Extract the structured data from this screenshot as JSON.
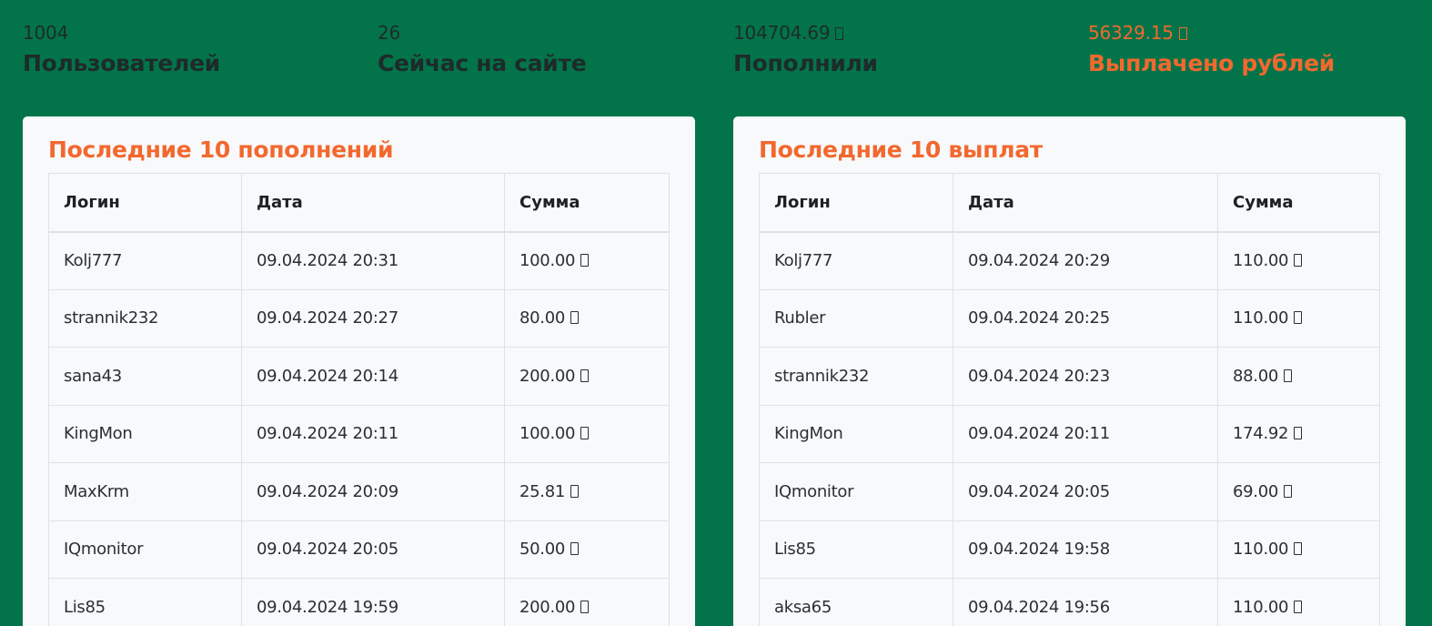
{
  "currency_glyph": "square-glyph-icon",
  "stats": [
    {
      "value": "1004",
      "label": "Пользователей"
    },
    {
      "value": "26",
      "label": "Сейчас на сайте"
    },
    {
      "value": "104704.69",
      "label": "Пополнили"
    },
    {
      "value": "56329.15",
      "label": "Выплачено рублей"
    }
  ],
  "deposits": {
    "title": "Последние 10 пополнений",
    "headers": {
      "login": "Логин",
      "date": "Дата",
      "sum": "Сумма"
    },
    "rows": [
      {
        "login": "Kolj777",
        "date": "09.04.2024 20:31",
        "sum": "100.00"
      },
      {
        "login": "strannik232",
        "date": "09.04.2024 20:27",
        "sum": "80.00"
      },
      {
        "login": "sana43",
        "date": "09.04.2024 20:14",
        "sum": "200.00"
      },
      {
        "login": "KingMon",
        "date": "09.04.2024 20:11",
        "sum": "100.00"
      },
      {
        "login": "MaxKrm",
        "date": "09.04.2024 20:09",
        "sum": "25.81"
      },
      {
        "login": "IQmonitor",
        "date": "09.04.2024 20:05",
        "sum": "50.00"
      },
      {
        "login": "Lis85",
        "date": "09.04.2024 19:59",
        "sum": "200.00"
      }
    ]
  },
  "payouts": {
    "title": "Последние 10 выплат",
    "headers": {
      "login": "Логин",
      "date": "Дата",
      "sum": "Сумма"
    },
    "rows": [
      {
        "login": "Kolj777",
        "date": "09.04.2024 20:29",
        "sum": "110.00"
      },
      {
        "login": "Rubler",
        "date": "09.04.2024 20:25",
        "sum": "110.00"
      },
      {
        "login": "strannik232",
        "date": "09.04.2024 20:23",
        "sum": "88.00"
      },
      {
        "login": "KingMon",
        "date": "09.04.2024 20:11",
        "sum": "174.92"
      },
      {
        "login": "IQmonitor",
        "date": "09.04.2024 20:05",
        "sum": "69.00"
      },
      {
        "login": "Lis85",
        "date": "09.04.2024 19:58",
        "sum": "110.00"
      },
      {
        "login": "aksa65",
        "date": "09.04.2024 19:56",
        "sum": "110.00"
      }
    ]
  },
  "colors": {
    "background": "#03744a",
    "accent": "#f2682f",
    "text": "#1d2b2a",
    "card": "#f8f9fa"
  }
}
